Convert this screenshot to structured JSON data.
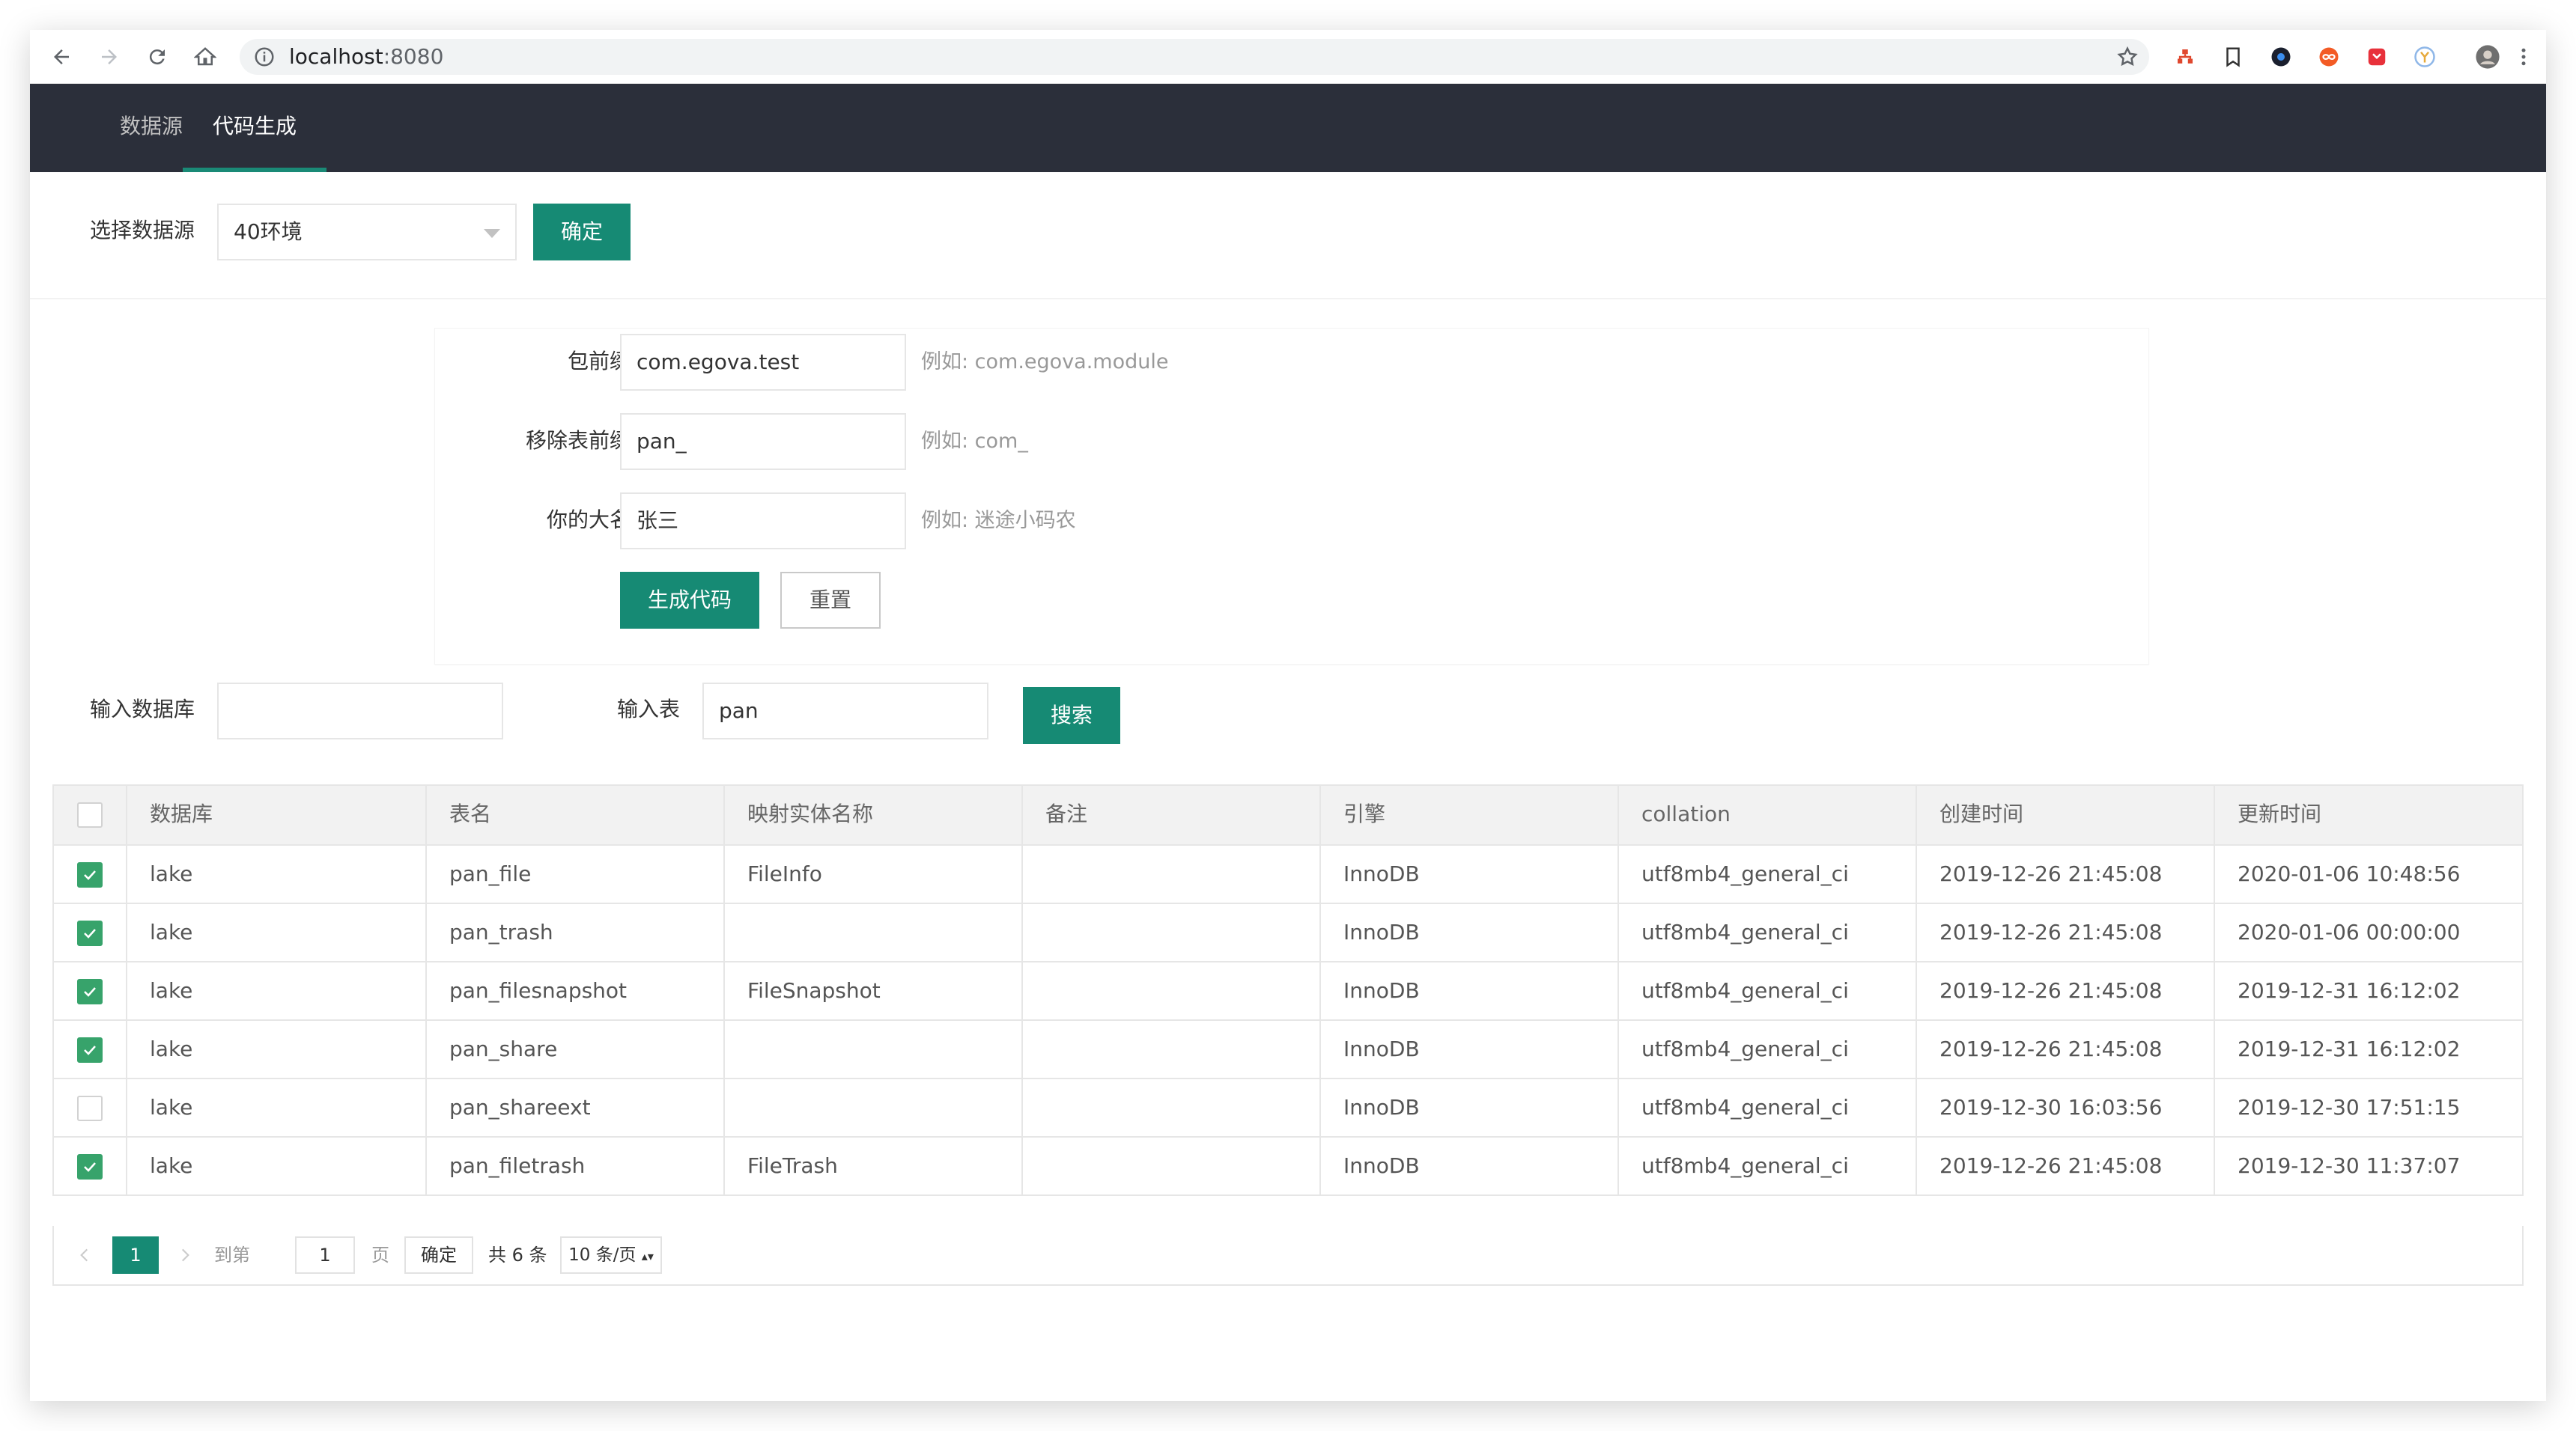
{
  "browser": {
    "url_host": "localhost",
    "url_port": ":8080"
  },
  "nav": {
    "tabs": [
      {
        "label": "数据源"
      },
      {
        "label": "代码生成"
      }
    ]
  },
  "datasource": {
    "label": "选择数据源",
    "selected": "40环境",
    "confirm_label": "确定"
  },
  "generator": {
    "package_prefix": {
      "label": "包前缀",
      "value": "com.egova.test",
      "hint": "例如: com.egova.module"
    },
    "remove_prefix": {
      "label": "移除表前缀",
      "value": "pan_",
      "hint": "例如: com_"
    },
    "author": {
      "label": "你的大名",
      "value": "张三",
      "hint": "例如: 迷途小码农"
    },
    "generate_label": "生成代码",
    "reset_label": "重置"
  },
  "search": {
    "db_label": "输入数据库",
    "db_value": "",
    "table_label": "输入表",
    "table_value": "pan",
    "search_label": "搜索"
  },
  "table": {
    "headers": [
      "数据库",
      "表名",
      "映射实体名称",
      "备注",
      "引擎",
      "collation",
      "创建时间",
      "更新时间"
    ],
    "rows": [
      {
        "checked": true,
        "db": "lake",
        "name": "pan_file",
        "entity": "FileInfo",
        "comment": "",
        "engine": "InnoDB",
        "collation": "utf8mb4_general_ci",
        "created": "2019-12-26 21:45:08",
        "updated": "2020-01-06 10:48:56"
      },
      {
        "checked": true,
        "db": "lake",
        "name": "pan_trash",
        "entity": "",
        "comment": "",
        "engine": "InnoDB",
        "collation": "utf8mb4_general_ci",
        "created": "2019-12-26 21:45:08",
        "updated": "2020-01-06 00:00:00"
      },
      {
        "checked": true,
        "db": "lake",
        "name": "pan_filesnapshot",
        "entity": "FileSnapshot",
        "comment": "",
        "engine": "InnoDB",
        "collation": "utf8mb4_general_ci",
        "created": "2019-12-26 21:45:08",
        "updated": "2019-12-31 16:12:02"
      },
      {
        "checked": true,
        "db": "lake",
        "name": "pan_share",
        "entity": "",
        "comment": "",
        "engine": "InnoDB",
        "collation": "utf8mb4_general_ci",
        "created": "2019-12-26 21:45:08",
        "updated": "2019-12-31 16:12:02"
      },
      {
        "checked": false,
        "db": "lake",
        "name": "pan_shareext",
        "entity": "",
        "comment": "",
        "engine": "InnoDB",
        "collation": "utf8mb4_general_ci",
        "created": "2019-12-30 16:03:56",
        "updated": "2019-12-30 17:51:15"
      },
      {
        "checked": true,
        "db": "lake",
        "name": "pan_filetrash",
        "entity": "FileTrash",
        "comment": "",
        "engine": "InnoDB",
        "collation": "utf8mb4_general_ci",
        "created": "2019-12-26 21:45:08",
        "updated": "2019-12-30 11:37:07"
      }
    ]
  },
  "pagination": {
    "prev_icon": "chevron-left-icon",
    "current_page": "1",
    "next_icon": "chevron-right-icon",
    "goto_label": "到第",
    "goto_value": "1",
    "page_unit": "页",
    "confirm_label": "确定",
    "total_label": "共 6 条",
    "page_size": "10 条/页"
  },
  "colors": {
    "accent": "#168a74",
    "nav_bg": "#2b2f3a",
    "checkbox": "#37a36b"
  }
}
